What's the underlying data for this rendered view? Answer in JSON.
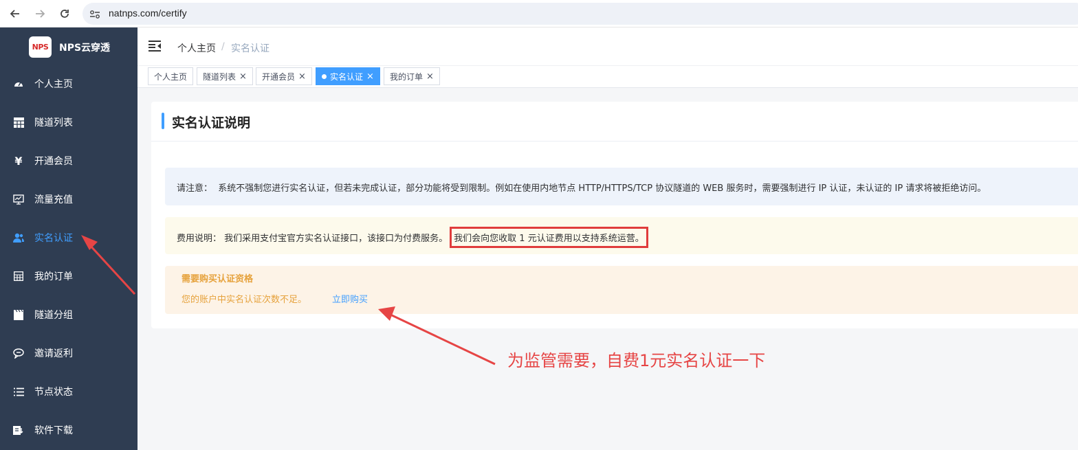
{
  "browser": {
    "url": "natnps.com/certify"
  },
  "sidebar": {
    "logo_text": "NPS",
    "brand": "NPS云穿透",
    "items": [
      {
        "label": "个人主页",
        "icon": "dashboard-icon"
      },
      {
        "label": "隧道列表",
        "icon": "table-icon"
      },
      {
        "label": "开通会员",
        "icon": "yen-icon"
      },
      {
        "label": "流量充值",
        "icon": "monitor-icon"
      },
      {
        "label": "实名认证",
        "icon": "user-icon",
        "active": true
      },
      {
        "label": "我的订单",
        "icon": "grid-icon"
      },
      {
        "label": "隧道分组",
        "icon": "clapper-icon"
      },
      {
        "label": "邀请返利",
        "icon": "chat-icon"
      },
      {
        "label": "节点状态",
        "icon": "list-icon"
      },
      {
        "label": "软件下载",
        "icon": "download-icon"
      }
    ]
  },
  "header": {
    "breadcrumb_home": "个人主页",
    "breadcrumb_sep": "/",
    "breadcrumb_current": "实名认证"
  },
  "tabs": [
    {
      "label": "个人主页",
      "closable": false
    },
    {
      "label": "隧道列表",
      "closable": true
    },
    {
      "label": "开通会员",
      "closable": true
    },
    {
      "label": "实名认证",
      "closable": true,
      "active": true
    },
    {
      "label": "我的订单",
      "closable": true
    }
  ],
  "tab_close_glyph": "×",
  "card": {
    "title": "实名认证说明",
    "notice_label": "请注意：",
    "notice_text": "系统不强制您进行实名认证，但若未完成认证，部分功能将受到限制。例如在使用内地节点 HTTP/HTTPS/TCP 协议隧道的 WEB 服务时，需要强制进行 IP 认证，未认证的 IP 请求将被拒绝访问。",
    "fee_label": "费用说明：",
    "fee_text": "我们采用支付宝官方实名认证接口，该接口为付费服务。",
    "fee_highlight": "我们会向您收取 1 元认证费用以支持系统运营。",
    "warn_title": "需要购买认证资格",
    "warn_body": "您的账户中实名认证次数不足。",
    "buy_link": "立即购买"
  },
  "annotation_text": "为监管需要，自费1元实名认证一下",
  "colors": {
    "sidebar_bg": "#2f3d52",
    "accent": "#409eff",
    "warn": "#e6a23c",
    "annotation": "#e64545"
  }
}
